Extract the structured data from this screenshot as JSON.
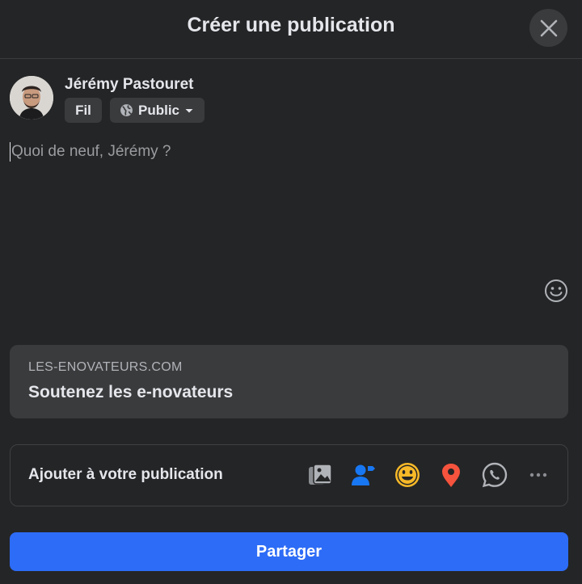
{
  "dialog": {
    "title": "Créer une publication"
  },
  "author": {
    "name": "Jérémy Pastouret",
    "audience_feed_label": "Fil",
    "privacy_label": "Public"
  },
  "composer": {
    "placeholder": "Quoi de neuf, Jérémy ?"
  },
  "link_preview": {
    "domain": "LES-ENOVATEURS.COM",
    "title": "Soutenez les e-novateurs"
  },
  "add_to_post": {
    "label": "Ajouter à votre publication",
    "icons": [
      "photo-video-icon",
      "tag-people-icon",
      "feeling-icon",
      "checkin-icon",
      "whatsapp-icon",
      "more-icon"
    ]
  },
  "share_button": {
    "label": "Partager"
  },
  "colors": {
    "background": "#242526",
    "surface": "#3a3b3c",
    "primary": "#2d6cf6",
    "photo_green": "#45bd62",
    "tag_blue": "#1877f2",
    "feeling_yellow": "#f7b928",
    "checkin_red": "#f5533d"
  }
}
